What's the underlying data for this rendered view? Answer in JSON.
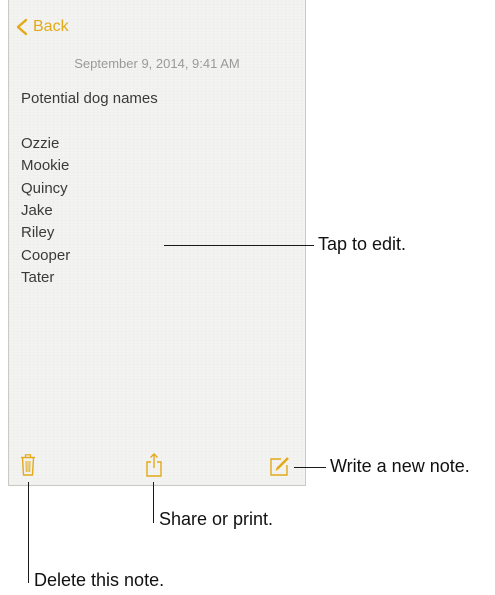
{
  "nav": {
    "back_label": "Back"
  },
  "note": {
    "timestamp": "September 9, 2014, 9:41 AM",
    "title": "Potential dog names",
    "lines": [
      "Ozzie",
      "Mookie",
      "Quincy",
      "Jake",
      "Riley",
      "Cooper",
      "Tater"
    ]
  },
  "toolbar": {
    "delete_icon": "trash-icon",
    "share_icon": "share-icon",
    "compose_icon": "compose-icon"
  },
  "callouts": {
    "edit": "Tap to edit.",
    "new_note": "Write a new note.",
    "share": "Share or print.",
    "delete": "Delete this note."
  },
  "colors": {
    "accent": "#e3a918",
    "paper": "#f3f3f2",
    "text": "#3a3a3a",
    "timestamp": "#9a9a98"
  }
}
